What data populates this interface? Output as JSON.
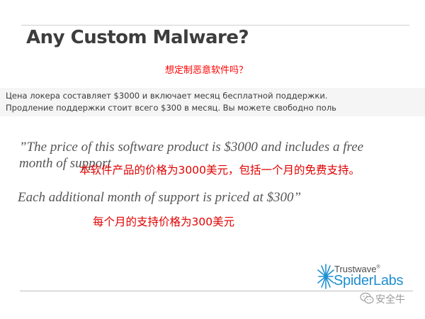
{
  "slide": {
    "title": "Any Custom Malware?",
    "title_cn": "想定制恶意软件吗？",
    "russian_lines": [
      "Цена локера составляет $3000 и включает месяц бесплатной поддержки.",
      "Продление поддержки стоит всего $300 в месяц. Вы можете свободно поль"
    ],
    "quote_lines": [
      "”The price of this software product is $3000 and includes a free",
      "month of support",
      "Each additional month of support is priced at $300”"
    ],
    "chinese_translations": [
      "本软件产品的价格为3000美元，包括一个月的免费支持。",
      "每个月的支持价格为300美元"
    ],
    "logo": {
      "top": "Trustwave",
      "bottom": "SpiderLabs",
      "reg_mark": "®",
      "icon": "spider-starburst-icon"
    },
    "watermark": {
      "text": "安全牛",
      "icon": "wechat-icon"
    },
    "colors": {
      "title": "#3d3d3d",
      "chinese_text": "#e10000",
      "russian_box": "#f5f5f5",
      "logo_blue": "#1f8fd0",
      "quote": "#555555"
    }
  }
}
